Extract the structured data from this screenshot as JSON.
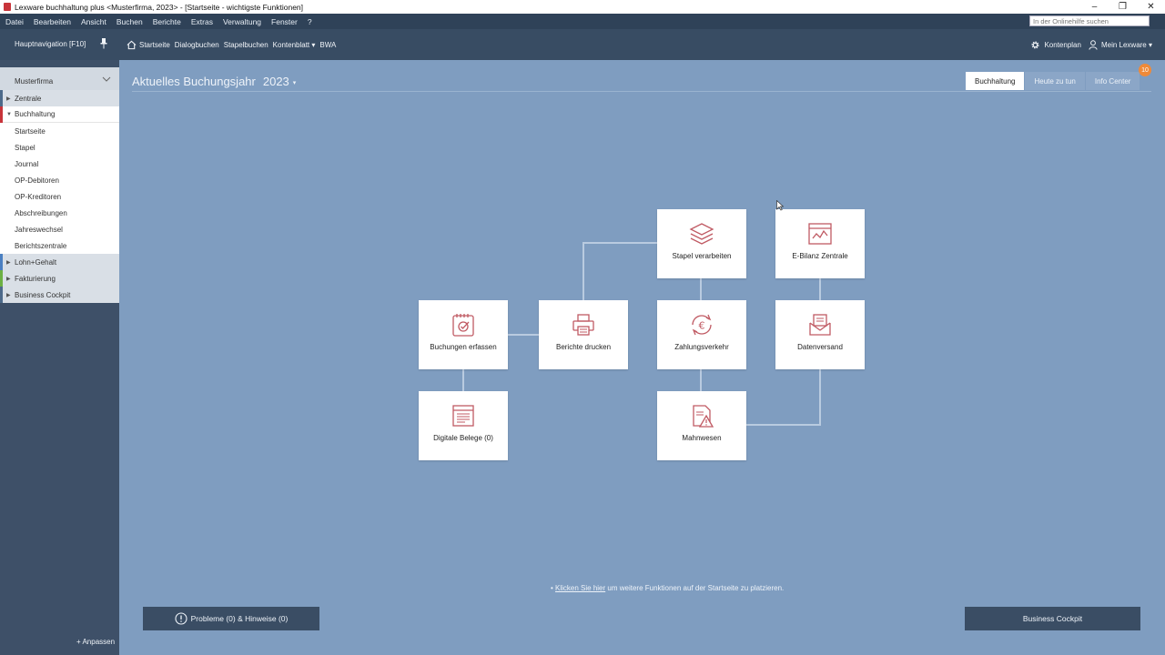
{
  "window": {
    "title": "Lexware buchhaltung plus <Musterfirma, 2023> - [Startseite - wichtigste Funktionen]",
    "minimize": "–",
    "restore": "❐",
    "close": "✕"
  },
  "menu": {
    "items": [
      "Datei",
      "Bearbeiten",
      "Ansicht",
      "Buchen",
      "Berichte",
      "Extras",
      "Verwaltung",
      "Fenster",
      "?"
    ],
    "search_placeholder": "In der Onlinehilfe suchen"
  },
  "toolbar": {
    "nav_label": "Hauptnavigation [F10]",
    "links": [
      "Startseite",
      "Dialogbuchen",
      "Stapelbuchen",
      "Kontenblatt ▾",
      "BWA"
    ],
    "kontenplan": "Kontenplan",
    "mein_lexware": "Mein Lexware ▾"
  },
  "sidebar": {
    "company": "Musterfirma",
    "items": [
      {
        "label": "Zentrale",
        "type": "group",
        "bar": "#4d6a8a"
      },
      {
        "label": "Buchhaltung",
        "type": "active",
        "bar": "#c8343a"
      },
      {
        "label": "Startseite",
        "type": "sub"
      },
      {
        "label": "Stapel",
        "type": "sub"
      },
      {
        "label": "Journal",
        "type": "sub"
      },
      {
        "label": "OP-Debitoren",
        "type": "sub"
      },
      {
        "label": "OP-Kreditoren",
        "type": "sub"
      },
      {
        "label": "Abschreibungen",
        "type": "sub"
      },
      {
        "label": "Jahreswechsel",
        "type": "sub"
      },
      {
        "label": "Berichtszentrale",
        "type": "sub"
      },
      {
        "label": "Lohn+Gehalt",
        "type": "group",
        "bar": "#4a7fc1"
      },
      {
        "label": "Fakturierung",
        "type": "group",
        "bar": "#6cb043"
      },
      {
        "label": "Business Cockpit",
        "type": "group",
        "bar": "#4d6a8a"
      }
    ],
    "anpassen": "+ Anpassen"
  },
  "main": {
    "heading": "Aktuelles Buchungsjahr",
    "year": "2023",
    "year_caret": "▾",
    "tabs": [
      "Buchhaltung",
      "Heute zu tun",
      "Info Center"
    ],
    "badge": "10",
    "tiles": {
      "stapel": "Stapel verarbeiten",
      "ebilanz": "E-Bilanz Zentrale",
      "buchungen": "Buchungen erfassen",
      "berichte": "Berichte drucken",
      "zahlung": "Zahlungsverkehr",
      "datenversand": "Datenversand",
      "belege": "Digitale Belege (0)",
      "mahnwesen": "Mahnwesen"
    },
    "hint_prefix": "• ",
    "hint_link": "Klicken Sie hier",
    "hint_suffix": " um weitere Funktionen auf der Startseite zu platzieren.",
    "probleme": "Probleme (0) & Hinweise (0)",
    "cockpit": "Business Cockpit"
  },
  "colors": {
    "background": "#7f9dc0",
    "icon": "#c05a63",
    "sidebar": "#3e5068",
    "accent": "#c8343a"
  }
}
